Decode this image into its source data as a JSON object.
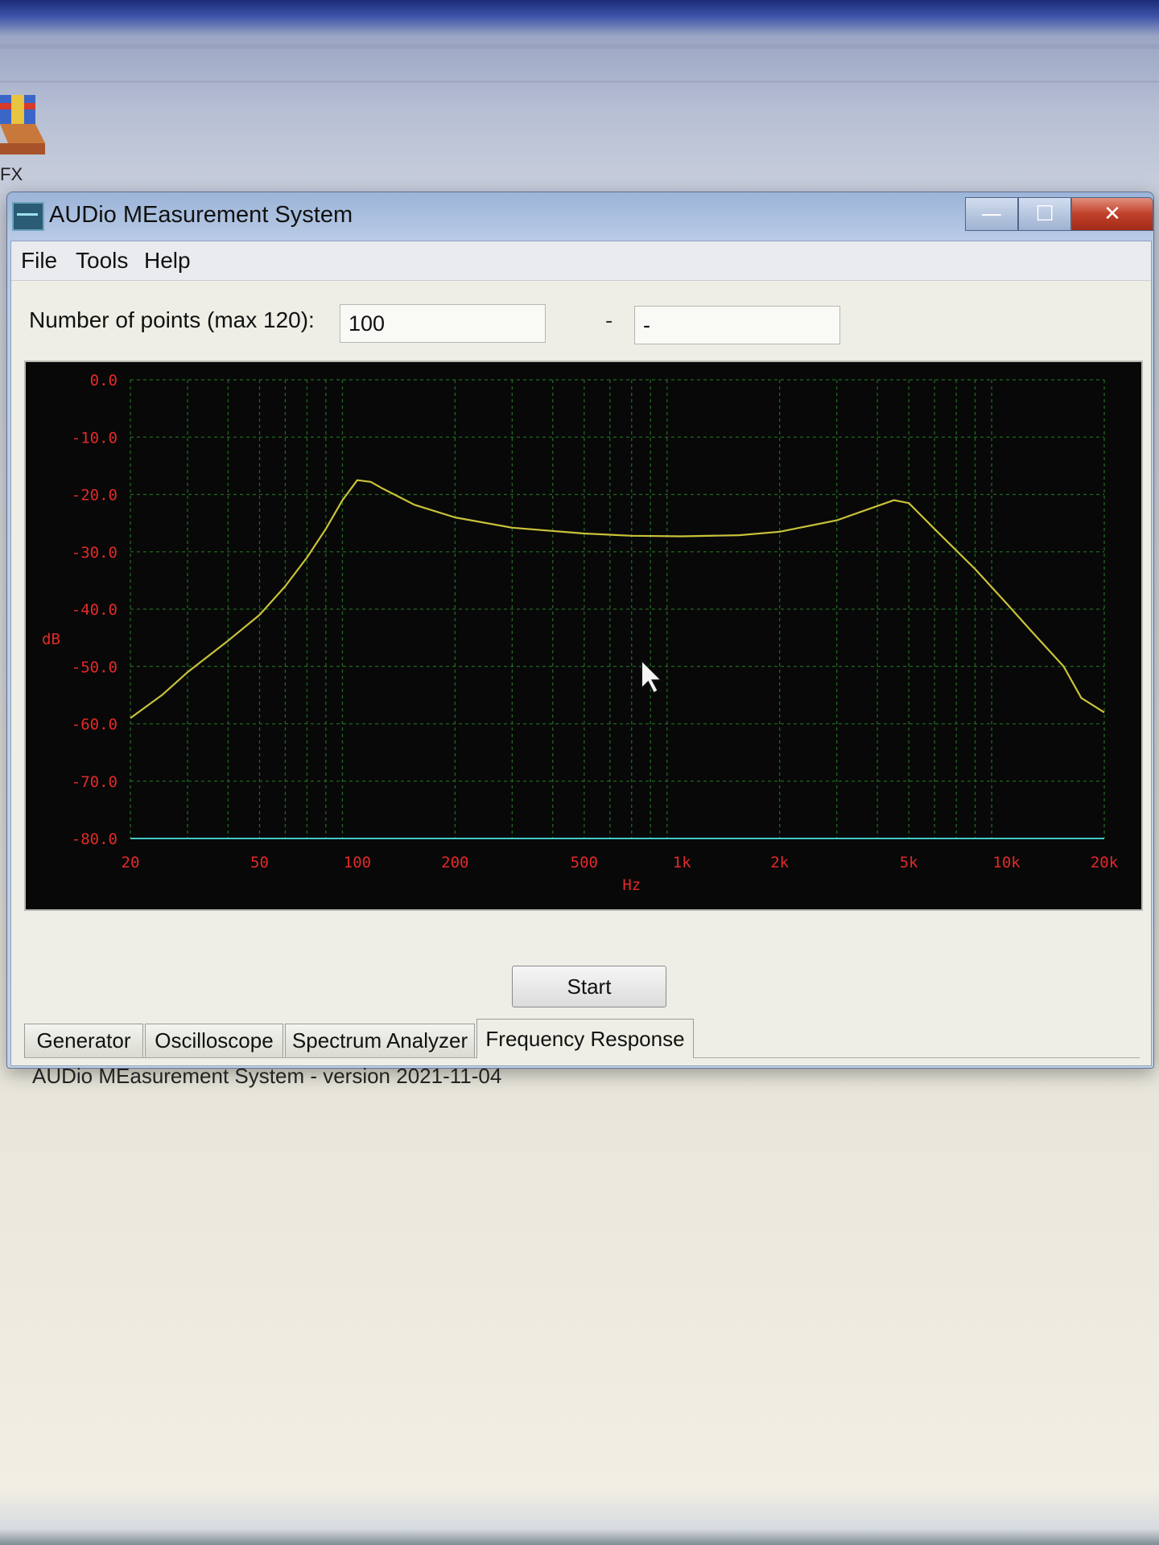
{
  "desktop": {
    "icon_label": "FX"
  },
  "window": {
    "title": "AUDio MEasurement System",
    "controls": {
      "minimize": "—",
      "maximize": "☐",
      "close": "✕"
    }
  },
  "menu": {
    "items": [
      "File",
      "Tools",
      "Help"
    ]
  },
  "settings": {
    "points_label": "Number of points (max 120):",
    "points_value": "100",
    "separator": "-",
    "second_value": "-"
  },
  "chart_data": {
    "type": "line",
    "xlabel": "Hz",
    "ylabel": "dB",
    "x_scale": "log",
    "xlim": [
      20,
      20000
    ],
    "ylim": [
      -80,
      0
    ],
    "x_ticks": [
      20,
      50,
      100,
      200,
      500,
      1000,
      2000,
      5000,
      10000,
      20000
    ],
    "x_tick_labels": [
      "20",
      "50",
      "100",
      "200",
      "500",
      "1k",
      "2k",
      "5k",
      "10k",
      "20k"
    ],
    "y_ticks": [
      0,
      -10,
      -20,
      -30,
      -40,
      -50,
      -60,
      -70,
      -80
    ],
    "y_tick_labels": [
      "0.0",
      "-10.0",
      "-20.0",
      "-30.0",
      "-40.0",
      "-50.0",
      "-60.0",
      "-70.0",
      "-80.0"
    ],
    "grid": true,
    "colors": {
      "background": "#080808",
      "grid": "#1f6a1f",
      "trace": "#c9c23a",
      "labels": "#e22a2a",
      "baseline": "#42c9c9"
    },
    "series": [
      {
        "x": [
          20,
          25,
          30,
          40,
          50,
          60,
          70,
          80,
          90,
          100,
          110,
          120,
          150,
          200,
          300,
          500,
          700,
          1000,
          1500,
          2000,
          3000,
          4000,
          4500,
          5000,
          6000,
          8000,
          10000,
          12000,
          15000,
          17000,
          20000
        ],
        "y": [
          -59,
          -55,
          -51,
          -45.5,
          -41,
          -36,
          -31,
          -26,
          -21,
          -17.5,
          -17.8,
          -19,
          -21.8,
          -24,
          -25.8,
          -26.8,
          -27.2,
          -27.3,
          -27.1,
          -26.5,
          -24.5,
          -22,
          -21,
          -21.5,
          -26,
          -33,
          -39,
          -44,
          -50,
          -55.5,
          -58
        ]
      }
    ]
  },
  "actions": {
    "start_label": "Start"
  },
  "tabs": [
    {
      "label": "Generator",
      "active": false
    },
    {
      "label": "Oscilloscope",
      "active": false
    },
    {
      "label": "Spectrum Analyzer",
      "active": false
    },
    {
      "label": "Frequency Response",
      "active": true
    }
  ],
  "status": {
    "text": "AUDio MEasurement System - version 2021-11-04"
  }
}
